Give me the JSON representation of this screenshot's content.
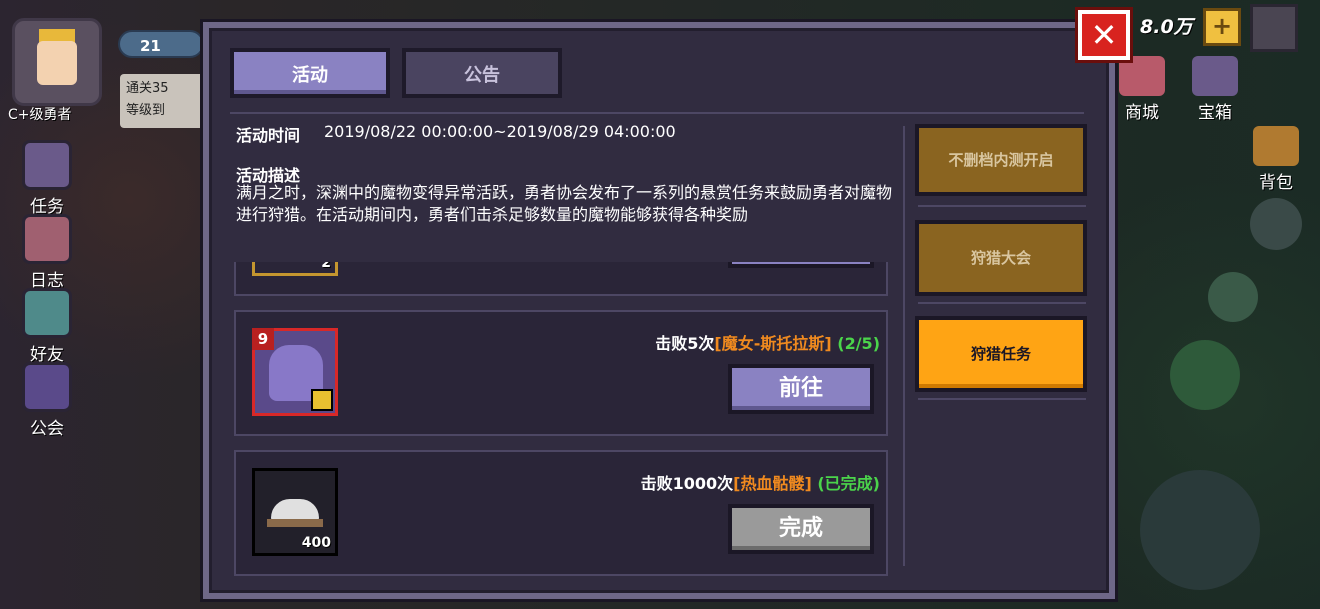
{
  "hud": {
    "player_rank": "C+级勇者",
    "level": "21",
    "task_tip": [
      "通关35",
      "等级到"
    ],
    "side_menu": [
      {
        "label": "任务",
        "icon": "exclamation-icon"
      },
      {
        "label": "日志",
        "icon": "log-icon"
      },
      {
        "label": "好友",
        "icon": "friend-icon"
      },
      {
        "label": "公会",
        "icon": "guild-banner-icon"
      }
    ],
    "gold": "8.0万",
    "plus": "+",
    "right_menu": [
      {
        "label": "商城",
        "icon": "shop-icon"
      },
      {
        "label": "宝箱",
        "icon": "chest-icon"
      },
      {
        "label": "背包",
        "icon": "backpack-icon"
      }
    ]
  },
  "dialog": {
    "close": "✕",
    "tabs": [
      {
        "label": "活动",
        "active": true
      },
      {
        "label": "公告",
        "active": false
      }
    ],
    "info": {
      "time_label": "活动时间",
      "time_value": "2019/08/22 00:00:00~2019/08/29 04:00:00",
      "desc_label": "活动描述",
      "desc_text": "满月之时，深渊中的魔物变得异常活跃，勇者协会发布了一系列的悬赏任务来鼓励勇者对魔物进行狩猎。在活动期间内，勇者们击杀足够数量的魔物能够获得各种奖励"
    },
    "tasks": [
      {
        "partial_count": "2"
      },
      {
        "level_badge": "9",
        "prefix": "击败5次",
        "target": "[魔女-斯托拉斯]",
        "progress": "(2/5)",
        "button": "前往",
        "state": "go"
      },
      {
        "prefix": "击败1000次",
        "target": "[热血骷髅]",
        "progress": "(已完成)",
        "button": "完成",
        "state": "done",
        "reward_count": "400"
      }
    ],
    "categories": [
      {
        "label": "不删档内测开启",
        "active": false
      },
      {
        "label": "狩猎大会",
        "active": false
      },
      {
        "label": "狩猎任务",
        "active": true
      }
    ]
  },
  "colors": {
    "accent_purple": "#8a82c2",
    "active_category": "#ffa414",
    "target_orange": "#f08a1f",
    "progress_green": "#4bd44b",
    "close_red": "#d8231f"
  }
}
